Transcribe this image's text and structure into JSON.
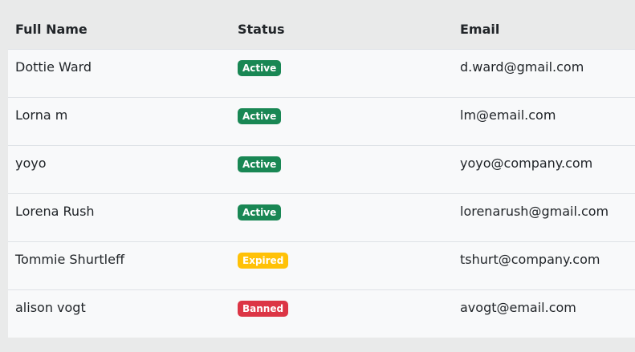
{
  "table": {
    "columns": [
      "Full Name",
      "Status",
      "Email"
    ],
    "rows": [
      {
        "name": "Dottie Ward",
        "status": "Active",
        "status_color": "#198754",
        "email": "d.ward@gmail.com"
      },
      {
        "name": "Lorna m",
        "status": "Active",
        "status_color": "#198754",
        "email": "lm@email.com"
      },
      {
        "name": "yoyo",
        "status": "Active",
        "status_color": "#198754",
        "email": "yoyo@company.com"
      },
      {
        "name": "Lorena Rush",
        "status": "Active",
        "status_color": "#198754",
        "email": "lorenarush@gmail.com"
      },
      {
        "name": "Tommie Shurtleff",
        "status": "Expired",
        "status_color": "#ffc107",
        "email": "tshurt@company.com"
      },
      {
        "name": "alison vogt",
        "status": "Banned",
        "status_color": "#dc3545",
        "email": "avogt@email.com"
      }
    ]
  }
}
